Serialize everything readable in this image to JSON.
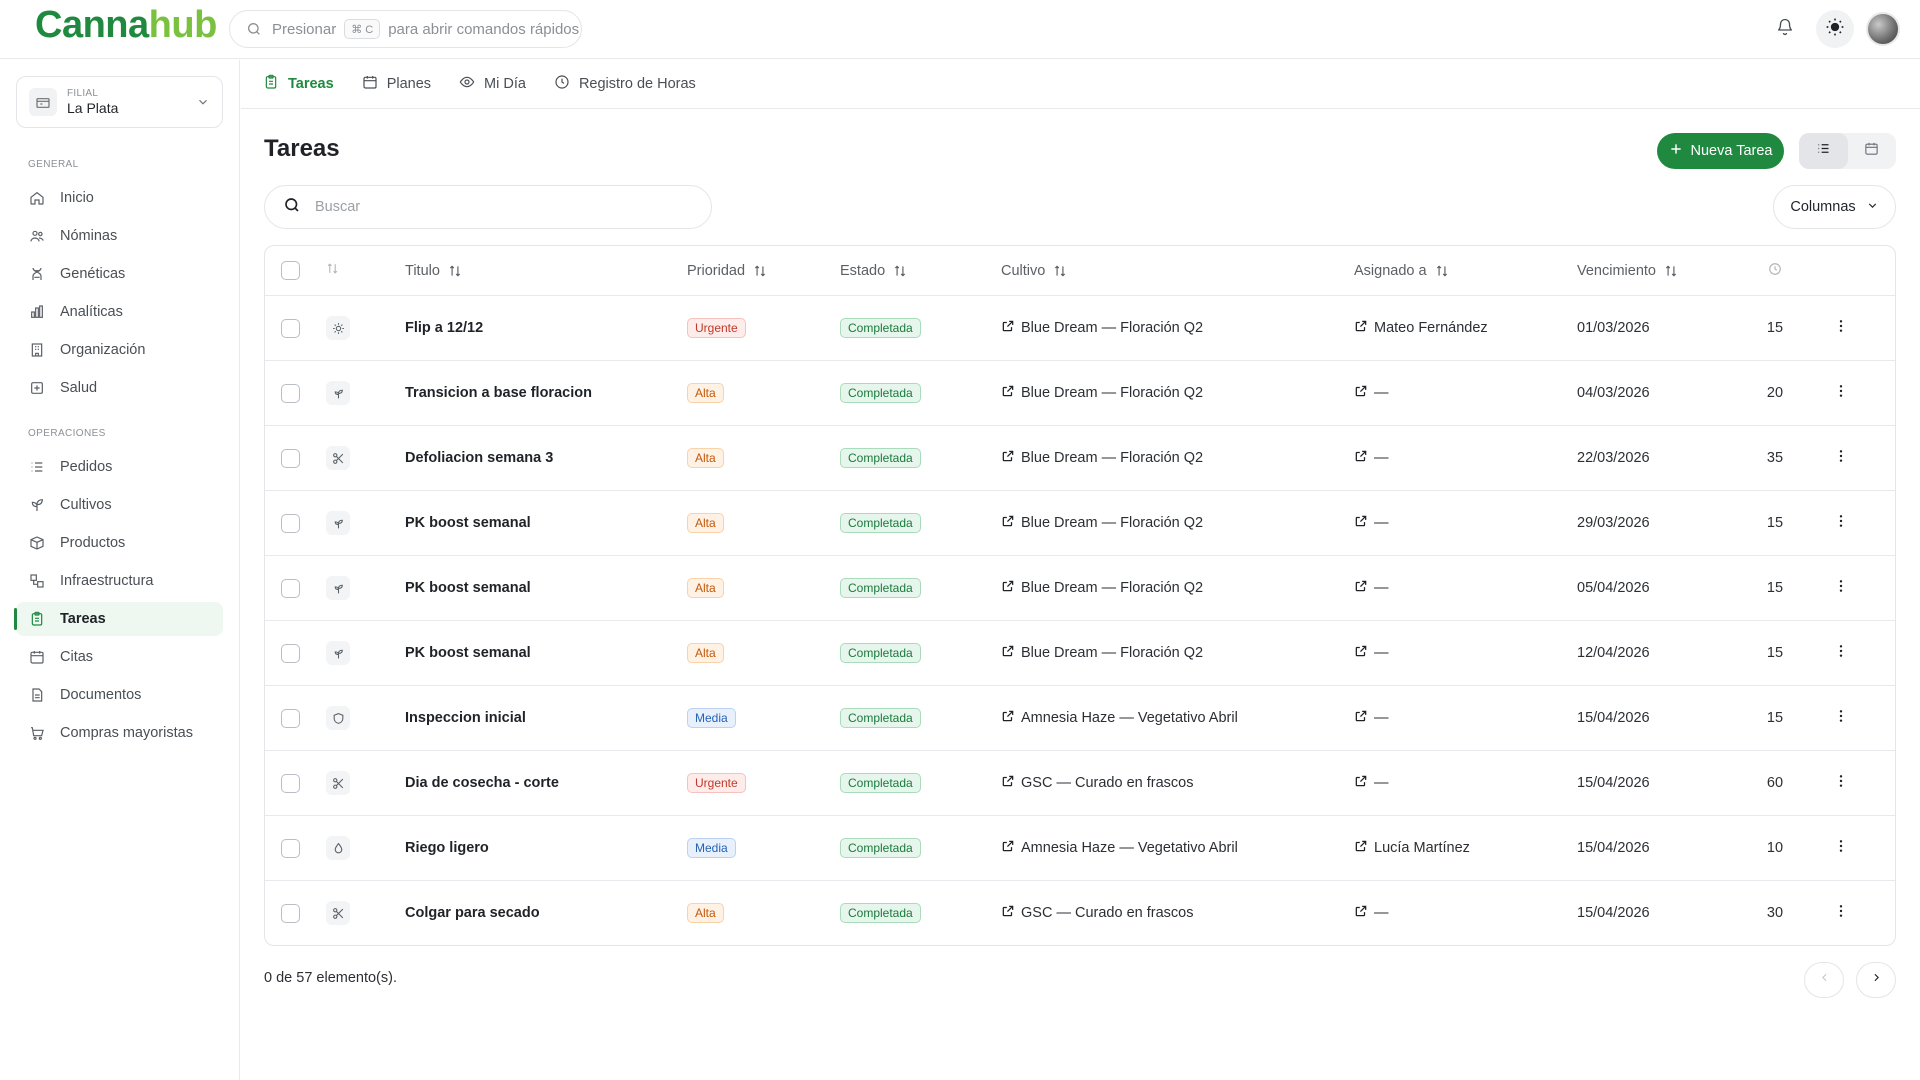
{
  "app": {
    "logo_part1": "Canna",
    "logo_part2": "hub",
    "command": {
      "prefix": "Presionar",
      "kbd": "⌘ C",
      "suffix": "para abrir comandos rápidos"
    }
  },
  "branch": {
    "label": "FILIAL",
    "value": "La Plata"
  },
  "sidebar": {
    "general_title": "GENERAL",
    "general": [
      {
        "label": "Inicio",
        "icon": "home-icon"
      },
      {
        "label": "Nóminas",
        "icon": "users-icon"
      },
      {
        "label": "Genéticas",
        "icon": "dna-icon"
      },
      {
        "label": "Analíticas",
        "icon": "bar-chart-icon"
      },
      {
        "label": "Organización",
        "icon": "building-icon"
      },
      {
        "label": "Salud",
        "icon": "health-icon"
      }
    ],
    "operations_title": "OPERACIONES",
    "operations": [
      {
        "label": "Pedidos",
        "icon": "list-icon"
      },
      {
        "label": "Cultivos",
        "icon": "plant-icon"
      },
      {
        "label": "Productos",
        "icon": "box-icon"
      },
      {
        "label": "Infraestructura",
        "icon": "infrastructure-icon"
      },
      {
        "label": "Tareas",
        "icon": "clipboard-icon",
        "active": true
      },
      {
        "label": "Citas",
        "icon": "calendar-icon"
      },
      {
        "label": "Documentos",
        "icon": "document-icon"
      },
      {
        "label": "Compras mayoristas",
        "icon": "cart-icon"
      }
    ]
  },
  "tabs": [
    {
      "label": "Tareas",
      "icon": "clipboard-icon",
      "active": true
    },
    {
      "label": "Planes",
      "icon": "calendar-icon"
    },
    {
      "label": "Mi Día",
      "icon": "eye-icon"
    },
    {
      "label": "Registro de Horas",
      "icon": "clock-icon"
    }
  ],
  "main": {
    "title": "Tareas",
    "new_button": "Nueva Tarea",
    "search_placeholder": "Buscar",
    "columns_button": "Columnas"
  },
  "table": {
    "headers": {
      "title": "Titulo",
      "priority": "Prioridad",
      "state": "Estado",
      "crop": "Cultivo",
      "assigned": "Asignado a",
      "due": "Vencimiento"
    },
    "rows": [
      {
        "type": "sun-icon",
        "title": "Flip a 12/12",
        "priority": "Urgente",
        "state": "Completada",
        "crop": "Blue Dream — Floración Q2",
        "assigned": "Mateo Fernández",
        "due": "01/03/2026",
        "duration": "15"
      },
      {
        "type": "sprout-icon",
        "title": "Transicion a base floracion",
        "priority": "Alta",
        "state": "Completada",
        "crop": "Blue Dream — Floración Q2",
        "assigned": "—",
        "due": "04/03/2026",
        "duration": "20"
      },
      {
        "type": "scissors-icon",
        "title": "Defoliacion semana 3",
        "priority": "Alta",
        "state": "Completada",
        "crop": "Blue Dream — Floración Q2",
        "assigned": "—",
        "due": "22/03/2026",
        "duration": "35"
      },
      {
        "type": "sprout-icon",
        "title": "PK boost semanal",
        "priority": "Alta",
        "state": "Completada",
        "crop": "Blue Dream — Floración Q2",
        "assigned": "—",
        "due": "29/03/2026",
        "duration": "15"
      },
      {
        "type": "sprout-icon",
        "title": "PK boost semanal",
        "priority": "Alta",
        "state": "Completada",
        "crop": "Blue Dream — Floración Q2",
        "assigned": "—",
        "due": "05/04/2026",
        "duration": "15"
      },
      {
        "type": "sprout-icon",
        "title": "PK boost semanal",
        "priority": "Alta",
        "state": "Completada",
        "crop": "Blue Dream — Floración Q2",
        "assigned": "—",
        "due": "12/04/2026",
        "duration": "15"
      },
      {
        "type": "shield-icon",
        "title": "Inspeccion inicial",
        "priority": "Media",
        "state": "Completada",
        "crop": "Amnesia Haze — Vegetativo Abril",
        "assigned": "—",
        "due": "15/04/2026",
        "duration": "15"
      },
      {
        "type": "scissors-icon",
        "title": "Dia de cosecha - corte",
        "priority": "Urgente",
        "state": "Completada",
        "crop": "GSC — Curado en frascos",
        "assigned": "—",
        "due": "15/04/2026",
        "duration": "60"
      },
      {
        "type": "droplet-icon",
        "title": "Riego ligero",
        "priority": "Media",
        "state": "Completada",
        "crop": "Amnesia Haze — Vegetativo Abril",
        "assigned": "Lucía Martínez",
        "due": "15/04/2026",
        "duration": "10"
      },
      {
        "type": "scissors-icon",
        "title": "Colgar para secado",
        "priority": "Alta",
        "state": "Completada",
        "crop": "GSC — Curado en frascos",
        "assigned": "—",
        "due": "15/04/2026",
        "duration": "30"
      }
    ]
  },
  "footer": {
    "count": "0 de 57 elemento(s)."
  },
  "colors": {
    "brand": "#1f8a3f",
    "brand_light": "#7ac13f",
    "urgent": "#c0392b",
    "high": "#c2590a",
    "medium": "#2563b5",
    "done": "#1a7a3c"
  }
}
